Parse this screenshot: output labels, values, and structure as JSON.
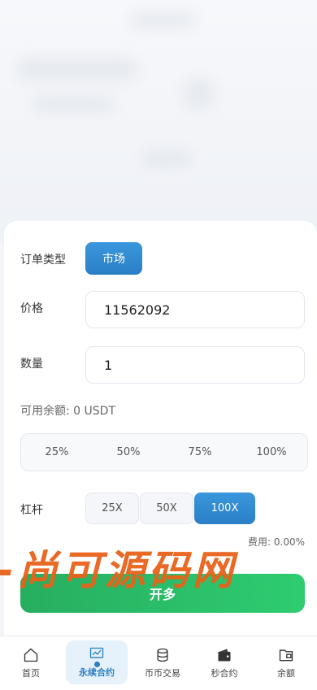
{
  "order": {
    "type_label": "订单类型",
    "market_button": "市场",
    "price_label": "价格",
    "price_value": "11562092",
    "quantity_label": "数量",
    "quantity_value": "1",
    "balance_text": "可用余额: 0 USDT",
    "percent_options": [
      "25%",
      "50%",
      "75%",
      "100%"
    ],
    "leverage_label": "杠杆",
    "leverage_options": [
      "25X",
      "50X",
      "100X"
    ],
    "leverage_selected": "100X",
    "fee_text": "费用: 0.00%",
    "open_button": "开多"
  },
  "watermark": "尚可源码网",
  "tabbar": {
    "items": [
      {
        "label": "首页",
        "icon": "home-icon"
      },
      {
        "label": "永续合约",
        "icon": "chart-icon"
      },
      {
        "label": "币币交易",
        "icon": "coins-icon"
      },
      {
        "label": "秒合约",
        "icon": "wallet-icon"
      },
      {
        "label": "余额",
        "icon": "folder-icon"
      }
    ],
    "active_index": 1
  },
  "colors": {
    "accent": "#2a7fc5",
    "open_green": "#2ecc71",
    "watermark": "#e8621a"
  }
}
